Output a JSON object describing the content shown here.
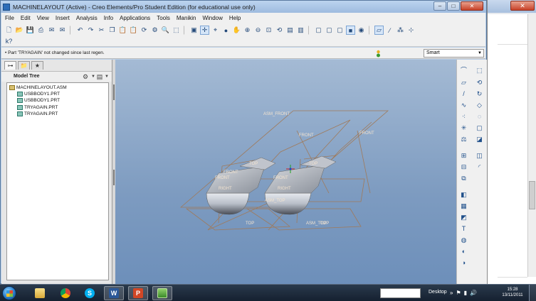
{
  "window": {
    "title": "MACHINELAYOUT (Active) - Creo Elements/Pro Student Edition (for educational use only)",
    "minimize": "–",
    "maximize": "□",
    "close": "✕"
  },
  "menu": [
    "File",
    "Edit",
    "View",
    "Insert",
    "Analysis",
    "Info",
    "Applications",
    "Tools",
    "Manikin",
    "Window",
    "Help"
  ],
  "status": {
    "message": "• Part 'TRYAGAIN' not changed since last regen.",
    "selection_filter": "Smart"
  },
  "model_tree": {
    "header": "Model Tree",
    "items": [
      {
        "label": "MACHINELAYOUT.ASM",
        "kind": "assembly"
      },
      {
        "label": "USBBODY1.PRT",
        "kind": "part"
      },
      {
        "label": "USBBODY1.PRT",
        "kind": "part"
      },
      {
        "label": "TRYAGAIN.PRT",
        "kind": "part"
      },
      {
        "label": "TRYAGAIN.PRT",
        "kind": "part"
      }
    ]
  },
  "viewport": {
    "datum_labels": {
      "asm_front": "ASM_FRONT",
      "front1": "FRONT",
      "front2": "FRONT",
      "front3": "FRONT",
      "front4": "FRONT",
      "front5": "FRONT",
      "top1": "TOP",
      "top2": "TOP",
      "top3": "TOP",
      "top4": "TOP",
      "right1": "RIGHT",
      "right2": "RIGHT",
      "asm_top": "ASM_TOP",
      "asm_top2": "ASM_TOP"
    }
  },
  "taskbar": {
    "desktop": "Desktop",
    "time": "15:28",
    "date": "13/11/2011",
    "apps": [
      {
        "name": "explorer",
        "icon": "folder-icon"
      },
      {
        "name": "chrome",
        "icon": "chrome-icon"
      },
      {
        "name": "skype",
        "icon": "skype-icon",
        "glyph": "S"
      },
      {
        "name": "word",
        "icon": "word-icon",
        "glyph": "W"
      },
      {
        "name": "powerpoint",
        "icon": "powerpoint-icon",
        "glyph": "P"
      },
      {
        "name": "creo",
        "icon": "creo-icon"
      }
    ]
  }
}
